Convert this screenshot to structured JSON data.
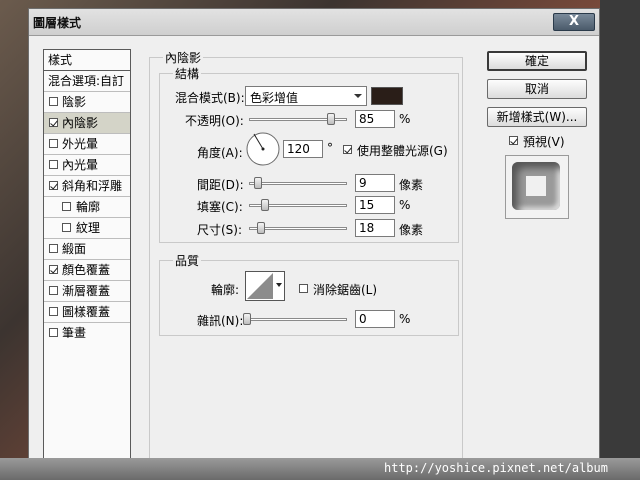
{
  "dialog": {
    "title": "圖層樣式",
    "close": "X"
  },
  "styles_list": {
    "header": "樣式",
    "blend_options": "混合選項:自訂",
    "items": [
      {
        "label": "陰影",
        "checked": false
      },
      {
        "label": "內陰影",
        "checked": true,
        "selected": true
      },
      {
        "label": "外光暈",
        "checked": false
      },
      {
        "label": "內光暈",
        "checked": false
      },
      {
        "label": "斜角和浮雕",
        "checked": true
      },
      {
        "label": "輪廓",
        "checked": false
      },
      {
        "label": "紋理",
        "checked": false
      },
      {
        "label": "緞面",
        "checked": false
      },
      {
        "label": "顏色覆蓋",
        "checked": true
      },
      {
        "label": "漸層覆蓋",
        "checked": false
      },
      {
        "label": "圖樣覆蓋",
        "checked": false
      },
      {
        "label": "筆畫",
        "checked": false
      }
    ]
  },
  "inner_shadow": {
    "section_title": "內陰影",
    "structure_title": "結構",
    "blend_mode_label": "混合模式(B):",
    "blend_mode_value": "色彩增值",
    "blend_color": "#2a1e18",
    "opacity_label": "不透明(O):",
    "opacity_value": "85",
    "opacity_unit": "%",
    "angle_label": "角度(A):",
    "angle_value": "120",
    "angle_unit": "°",
    "global_light_label": "使用整體光源(G)",
    "global_light_checked": true,
    "distance_label": "間距(D):",
    "distance_value": "9",
    "distance_unit": "像素",
    "choke_label": "填塞(C):",
    "choke_value": "15",
    "choke_unit": "%",
    "size_label": "尺寸(S):",
    "size_value": "18",
    "size_unit": "像素"
  },
  "quality": {
    "title": "品質",
    "contour_label": "輪廓:",
    "antialias_label": "消除鋸齒(L)",
    "antialias_checked": false,
    "noise_label": "雜訊(N):",
    "noise_value": "0",
    "noise_unit": "%"
  },
  "buttons": {
    "ok": "確定",
    "cancel": "取消",
    "new_style": "新增樣式(W)...",
    "preview_label": "預視(V)",
    "preview_checked": true
  },
  "watermark": "http://yoshice.pixnet.net/album"
}
